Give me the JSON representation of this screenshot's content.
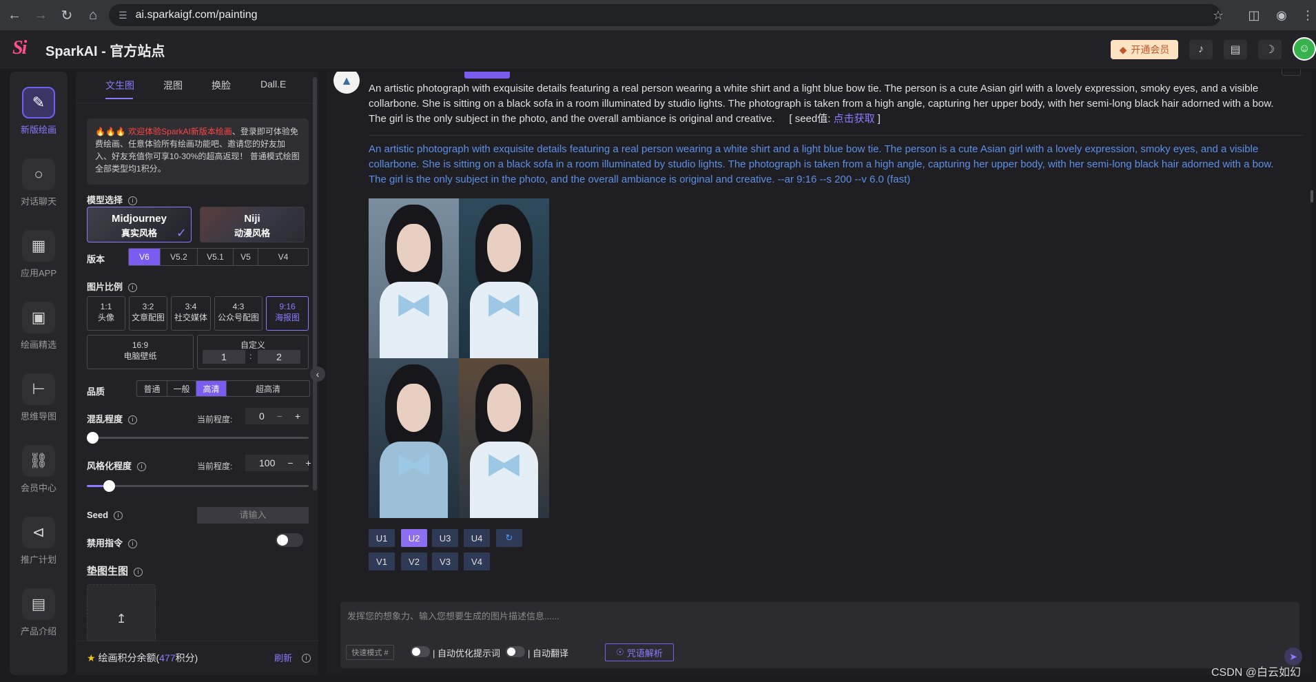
{
  "browser": {
    "url": "ai.sparkaigf.com/painting"
  },
  "header": {
    "logo": "Si",
    "title": "SparkAI - 官方站点",
    "vip_label": "开通会员"
  },
  "rail": {
    "items": [
      {
        "label": "新版绘画",
        "icon": "brush-icon"
      },
      {
        "label": "对话聊天",
        "icon": "chat-icon"
      },
      {
        "label": "应用APP",
        "icon": "apps-icon"
      },
      {
        "label": "绘画精选",
        "icon": "gallery-icon"
      },
      {
        "label": "思维导图",
        "icon": "mindmap-icon"
      },
      {
        "label": "会员中心",
        "icon": "cart-icon"
      },
      {
        "label": "推广计划",
        "icon": "share-icon"
      },
      {
        "label": "产品介绍",
        "icon": "product-icon"
      }
    ]
  },
  "panel": {
    "tabs": [
      "文生图",
      "混图",
      "换脸",
      "Dall.E"
    ],
    "notice_hot": "🔥🔥🔥 欢迎体验SparkAI新版本绘画",
    "notice_rest": "、登录即可体验免费绘画、任意体验所有绘画功能吧、邀请您的好友加入、好友充值你可享10-30%的超高返现！ 普通模式绘图全部类型均1积分。",
    "model_label": "模型选择",
    "models": [
      {
        "name": "Midjourney",
        "sub": "真实风格"
      },
      {
        "name": "Niji",
        "sub": "动漫风格"
      }
    ],
    "version_label": "版本",
    "versions": [
      "V6",
      "V5.2",
      "V5.1",
      "V5",
      "V4"
    ],
    "ratio_label": "图片比例",
    "ratios": [
      {
        "r": "1:1",
        "d": "头像"
      },
      {
        "r": "3:2",
        "d": "文章配图"
      },
      {
        "r": "3:4",
        "d": "社交媒体"
      },
      {
        "r": "4:3",
        "d": "公众号配图"
      },
      {
        "r": "9:16",
        "d": "海报图"
      }
    ],
    "ratio_wide": {
      "r": "16:9",
      "d": "电脑壁纸"
    },
    "ratio_custom": {
      "label": "自定义",
      "w": "1",
      "sep": ":",
      "h": "2"
    },
    "quality_label": "品质",
    "qualities": [
      "普通",
      "一般",
      "高清",
      "超高清"
    ],
    "chaos_label": "混乱程度",
    "chaos_current_label": "当前程度:",
    "chaos_value": "0",
    "chaos_fraction": 0.0,
    "stylize_label": "风格化程度",
    "stylize_current_label": "当前程度:",
    "stylize_value": "100",
    "stylize_fraction": 0.1,
    "seed_label": "Seed",
    "seed_placeholder": "请输入",
    "noprompt_label": "禁用指令",
    "imgref_label": "垫图生图",
    "points_label_pre": "绘画积分余额(",
    "points_value": "477",
    "points_label_post": "积分)",
    "refresh_label": "刷新"
  },
  "main": {
    "prompt_text": "An artistic photograph with exquisite details featuring a real person wearing a white shirt and a light blue bow tie. The person is a cute Asian girl with a lovely expression, smoky eyes, and a visible collarbone. She is sitting on a black sofa in a room illuminated by studio lights. The photograph is taken from a high angle, capturing her upper body, with her semi-long black hair adorned with a bow. The girl is the only subject in the photo, and the overall ambiance is original and creative.",
    "seed_prefix": "[ seed值:",
    "seed_link": "点击获取",
    "seed_suffix": "]",
    "final_prompt": "An artistic photograph with exquisite details featuring a real person wearing a white shirt and a light blue bow tie. The person is a cute Asian girl with a lovely expression, smoky eyes, and a visible collarbone. She is sitting on a black sofa in a room illuminated by studio lights. The photograph is taken from a high angle, capturing her upper body, with her semi-long black hair adorned with a bow. The girl is the only subject in the photo, and the overall ambiance is original and creative. --ar 9:16 --s 200 --v 6.0  (fast)",
    "upscale_buttons": [
      "U1",
      "U2",
      "U3",
      "U4"
    ],
    "variation_buttons": [
      "V1",
      "V2",
      "V3",
      "V4"
    ],
    "input_placeholder": "发挥您的想象力、输入您想要生成的图片描述信息......",
    "quick_mode": "快速模式 #",
    "auto_optimize": "自动优化提示词",
    "auto_translate": "自动翻译",
    "analyze_label": "咒语解析"
  },
  "watermark": "CSDN @白云如幻",
  "colors": {
    "accent": "#8b7bff",
    "selected": "#7a5cf0",
    "link": "#5c8fe6"
  }
}
